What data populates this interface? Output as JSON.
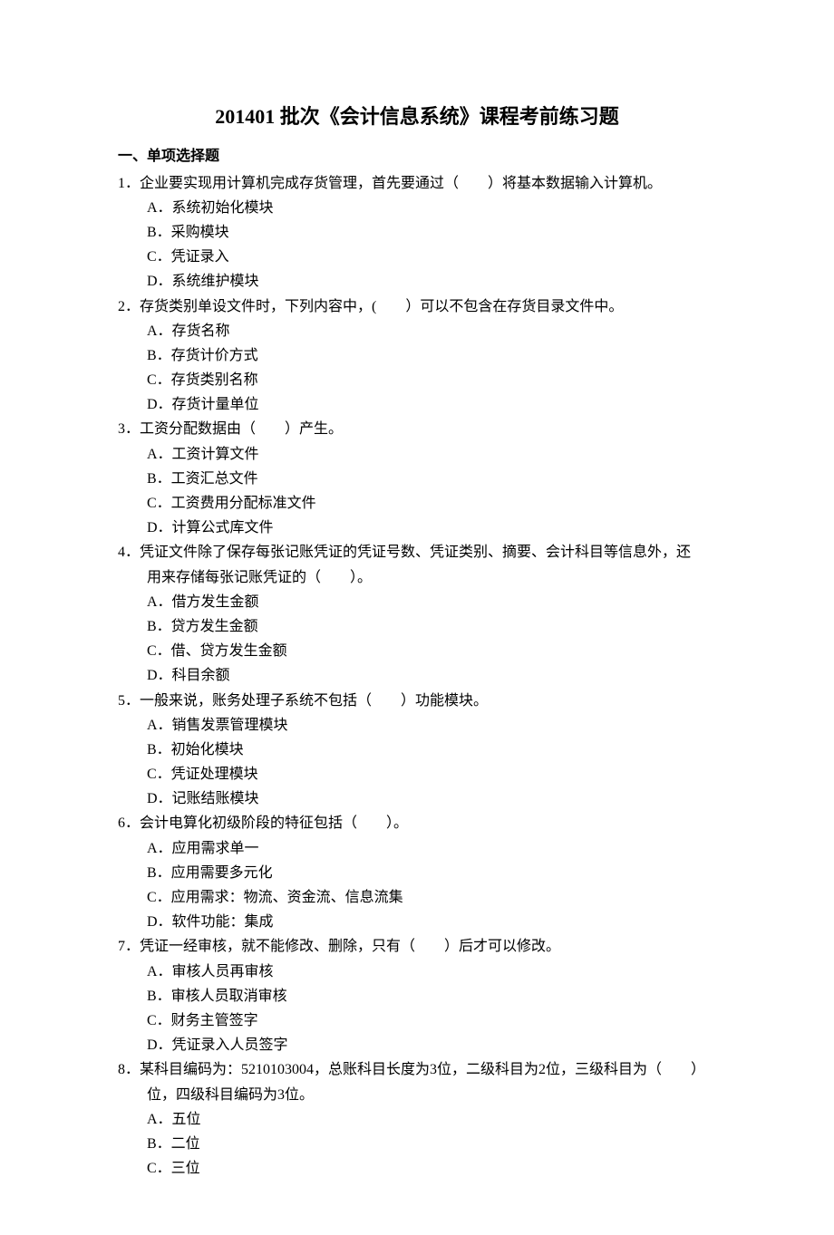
{
  "title": "201401 批次《会计信息系统》课程考前练习题",
  "sectionHeading": "一、单项选择题",
  "questions": [
    {
      "num": "1．",
      "text": "企业要实现用计算机完成存货管理，首先要通过（　　）将基本数据输入计算机。",
      "options": [
        "A．系统初始化模块",
        "B．采购模块",
        "C．凭证录入",
        "D．系统维护模块"
      ]
    },
    {
      "num": "2．",
      "text": "存货类别单设文件时，下列内容中，(　　）可以不包含在存货目录文件中。",
      "options": [
        "A．存货名称",
        "B．存货计价方式",
        "C．存货类别名称",
        "D．存货计量单位"
      ]
    },
    {
      "num": "3．",
      "text": "工资分配数据由（　　）产生。",
      "options": [
        "A．工资计算文件",
        "B．工资汇总文件",
        "C．工资费用分配标准文件",
        "D．计算公式库文件"
      ]
    },
    {
      "num": "4．",
      "text": "凭证文件除了保存每张记账凭证的凭证号数、凭证类别、摘要、会计科目等信息外，还",
      "textCont": "用来存储每张记账凭证的（　　）。",
      "options": [
        "A．借方发生金额",
        "B．贷方发生金额",
        "C．借、贷方发生金额",
        "D．科目余额"
      ]
    },
    {
      "num": "5．",
      "text": "一般来说，账务处理子系统不包括（　　）功能模块。",
      "options": [
        "A．销售发票管理模块",
        "B．初始化模块",
        "C．凭证处理模块",
        "D．记账结账模块"
      ]
    },
    {
      "num": "6．",
      "text": "会计电算化初级阶段的特征包括（　　）。",
      "options": [
        "A．应用需求单一",
        "B．应用需要多元化",
        "C．应用需求：物流、资金流、信息流集",
        "D．软件功能：集成"
      ]
    },
    {
      "num": "7．",
      "text": "凭证一经审核，就不能修改、删除，只有（　　）后才可以修改。",
      "options": [
        "A．审核人员再审核",
        "B．审核人员取消审核",
        "C．财务主管签字",
        "D．凭证录入人员签字"
      ]
    },
    {
      "num": "8．",
      "text": "某科目编码为：5210103004，总账科目长度为3位，二级科目为2位，三级科目为（　　）",
      "textCont": "位，四级科目编码为3位。",
      "options": [
        "A．五位",
        "B．二位",
        "C．三位"
      ]
    }
  ]
}
